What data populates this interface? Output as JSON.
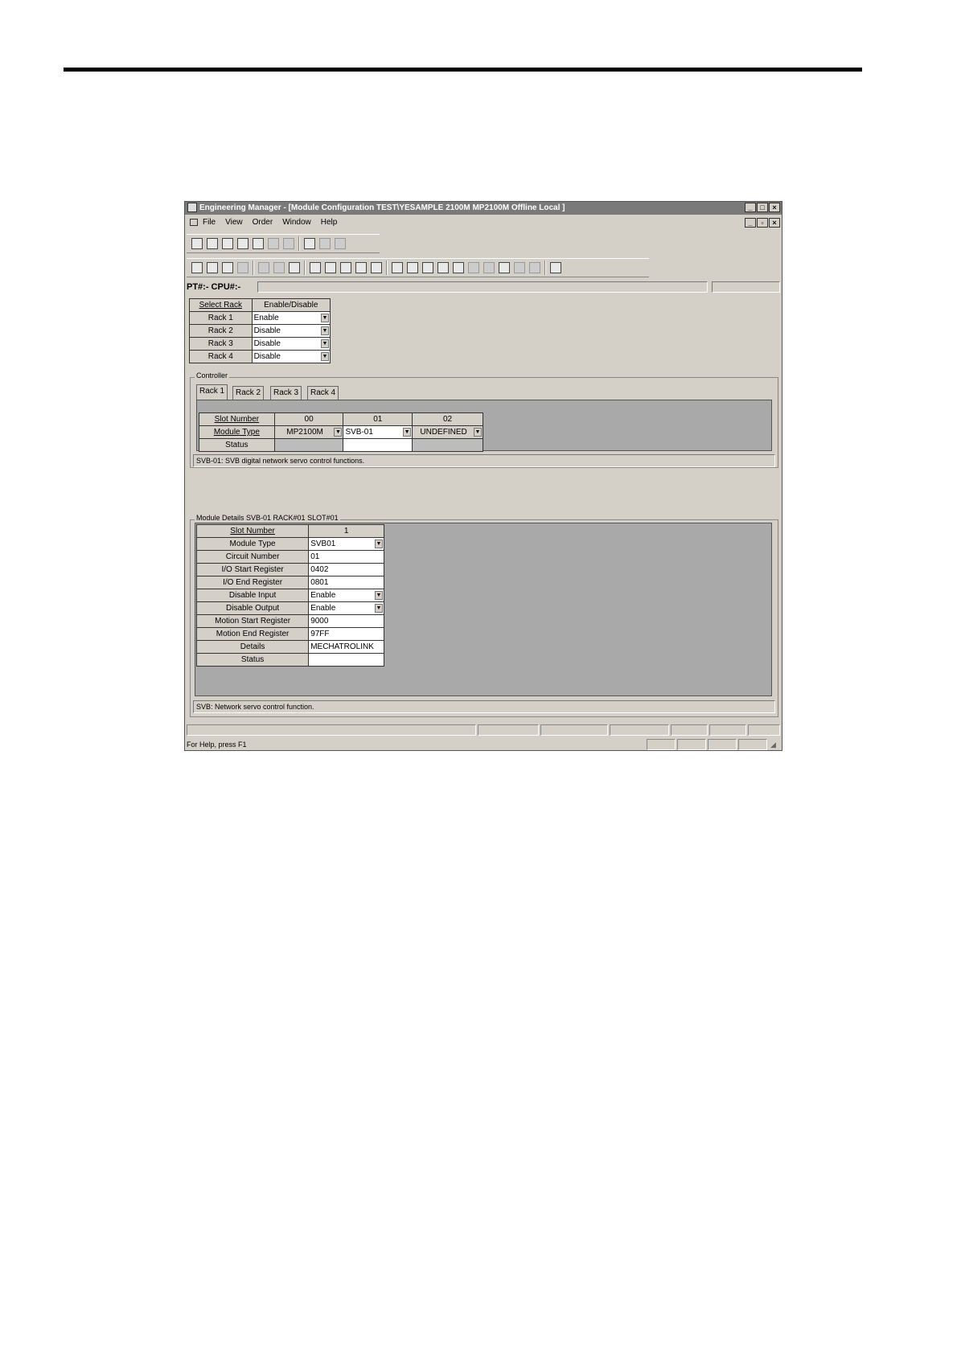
{
  "window": {
    "title": "Engineering Manager - [Module Configuration   TEST\\YESAMPLE 2100M MP2100M  Offline Local ]",
    "controls": [
      "_",
      "□",
      "×"
    ],
    "mdi_controls": [
      "_",
      "▫",
      "×"
    ]
  },
  "menu": [
    "File",
    "View",
    "Order",
    "Window",
    "Help"
  ],
  "location": "PT#:- CPU#:-",
  "rack_select": {
    "headers": [
      "Select Rack",
      "Enable/Disable"
    ],
    "rows": [
      {
        "rack": "Rack 1",
        "value": "Enable"
      },
      {
        "rack": "Rack 2",
        "value": "Disable"
      },
      {
        "rack": "Rack 3",
        "value": "Disable"
      },
      {
        "rack": "Rack 4",
        "value": "Disable"
      }
    ]
  },
  "controller": {
    "label": "Controller",
    "tabs": [
      "Rack 1",
      "Rack 2",
      "Rack 3",
      "Rack 4"
    ],
    "row_labels": [
      "Slot Number",
      "Module Type",
      "Status"
    ],
    "slots": [
      {
        "slot": "00",
        "module": "MP2100M",
        "status": ""
      },
      {
        "slot": "01",
        "module": "SVB-01",
        "status": ""
      },
      {
        "slot": "02",
        "module": "UNDEFINED",
        "status": ""
      }
    ],
    "description": "SVB-01: SVB digital network servo control functions."
  },
  "module_details": {
    "label": "Module Details  SVB-01  RACK#01  SLOT#01",
    "rows": [
      {
        "label": "Slot Number",
        "value": "1"
      },
      {
        "label": "Module Type",
        "value": "SVB01"
      },
      {
        "label": "Circuit Number",
        "value": "01"
      },
      {
        "label": "I/O Start Register",
        "value": "0402"
      },
      {
        "label": "I/O End Register",
        "value": "0801"
      },
      {
        "label": "Disable Input",
        "value": "Enable"
      },
      {
        "label": "Disable Output",
        "value": "Enable"
      },
      {
        "label": "Motion Start Register",
        "value": "9000"
      },
      {
        "label": "Motion End Register",
        "value": "97FF"
      },
      {
        "label": "Details",
        "value": "MECHATROLINK"
      },
      {
        "label": "Status",
        "value": ""
      }
    ],
    "description": "SVB: Network servo control function."
  },
  "statusbar": {
    "text": "For Help, press F1"
  }
}
